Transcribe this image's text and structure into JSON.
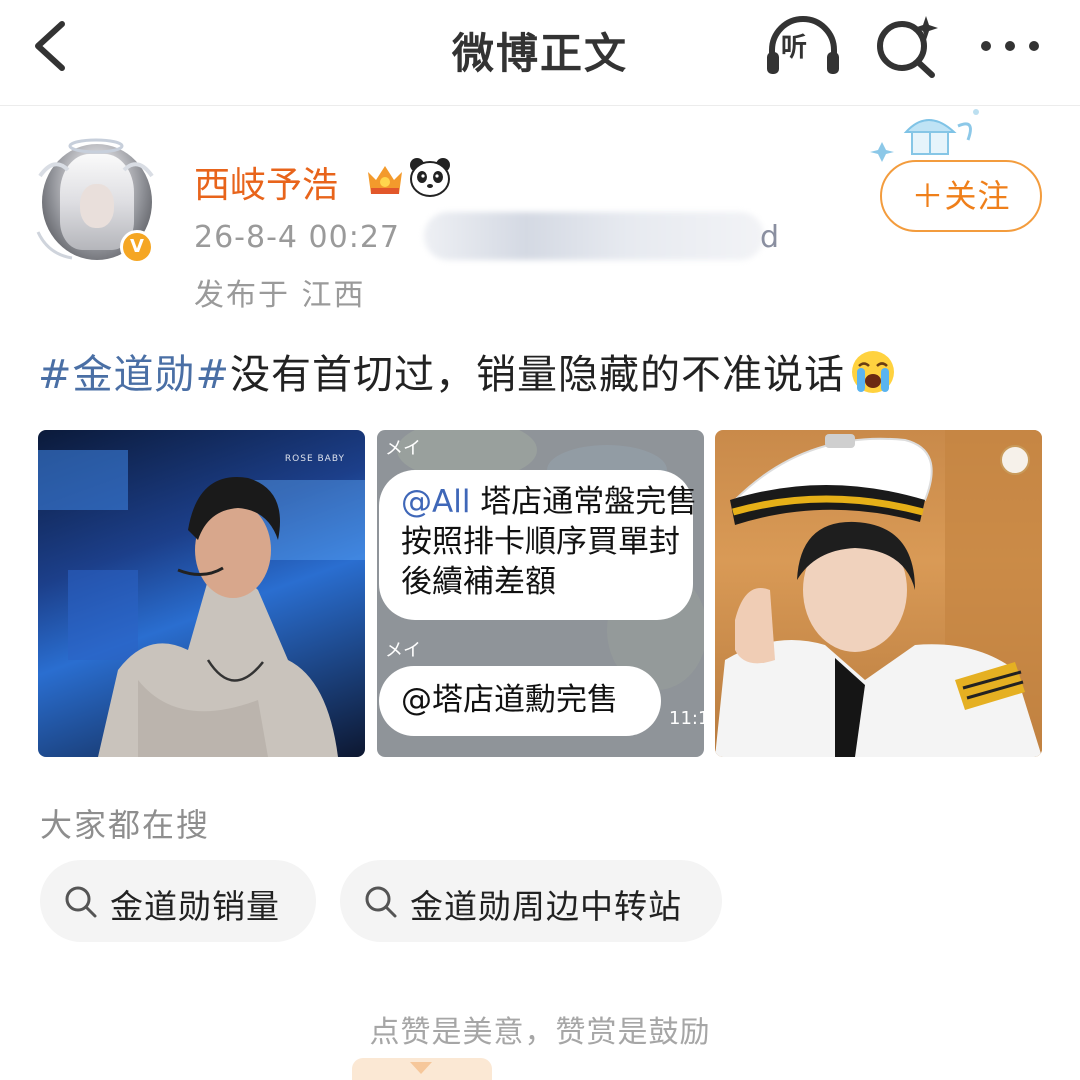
{
  "nav": {
    "title": "微博正文",
    "listen_label": "听",
    "icons": [
      "back-icon",
      "listen-headphones-icon",
      "search-spark-icon",
      "more-icon"
    ]
  },
  "post": {
    "author": {
      "name": "西岐予浩",
      "verified": true,
      "verified_badge": "V",
      "badges": [
        "vip-crown-icon",
        "panda-icon"
      ]
    },
    "time": "26-8-4 00:27",
    "source_suffix": "d",
    "location": "发布于 江西",
    "follow_label": "＋关注",
    "text": {
      "hashtag": "#金道勋#",
      "body": "没有首切过，销量隐藏的不准说话",
      "emoji": "crying-face-emoji"
    },
    "images": [
      {
        "watermark": "ROSE BABY"
      },
      {
        "chat": [
          {
            "sender": "メイ",
            "mention": "@All",
            "lines": [
              " 塔店通常盤完售",
              "按照排卡順序買單封",
              "後續補差額"
            ]
          },
          {
            "sender": "メイ",
            "lines": [
              "@塔店道勳完售"
            ]
          }
        ],
        "time": "11:1"
      },
      {
        "watermark": ""
      }
    ]
  },
  "trending": {
    "heading": "大家都在搜",
    "items": [
      "金道勋销量",
      "金道勋周边中转站"
    ]
  },
  "footer": {
    "hint": "点赞是美意，赞赏是鼓励"
  },
  "colors": {
    "accent_orange": "#ef7f1a",
    "username_orange": "#e8641b",
    "hashtag_blue": "#4a6fa5",
    "muted_gray": "#9a9a9a"
  }
}
